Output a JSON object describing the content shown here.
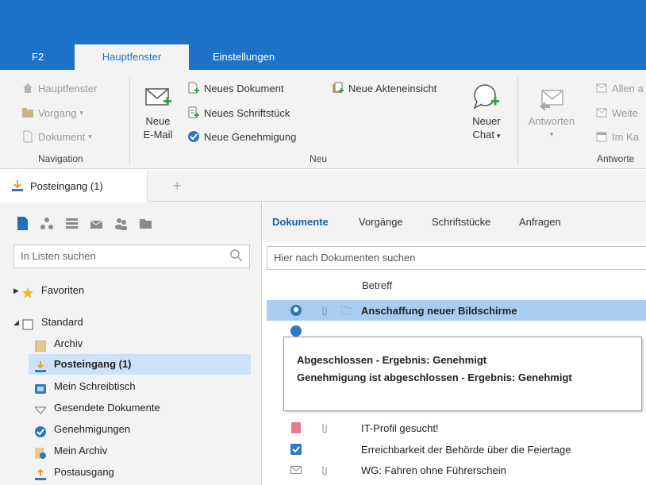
{
  "ribbon_tabs": [
    "F2",
    "Hauptfenster",
    "Einstellungen"
  ],
  "navigation": {
    "items": [
      "Hauptfenster",
      "Vorgang",
      "Dokument"
    ],
    "group_label": "Navigation"
  },
  "neu": {
    "neue_email_line1": "Neue",
    "neue_email_line2": "E-Mail",
    "items": [
      "Neues Dokument",
      "Neues Schriftstück",
      "Neue Genehmigung",
      "Neue Akteneinsicht"
    ],
    "neuer_chat_line1": "Neuer",
    "neuer_chat_line2": "Chat",
    "group_label": "Neu"
  },
  "antworten": {
    "big_label": "Antworten",
    "items": [
      "Allen a",
      "Weite",
      "Im Ka"
    ],
    "group_label": "Antworte"
  },
  "doc_tab": {
    "label": "Posteingang (1)",
    "add": "+"
  },
  "left": {
    "search_placeholder": "In Listen suchen",
    "tree": [
      "Favoriten",
      "Standard",
      "Archiv",
      "Posteingang (1)",
      "Mein Schreibtisch",
      "Gesendete Dokumente",
      "Genehmigungen",
      "Mein Archiv",
      "Postausgang"
    ]
  },
  "right": {
    "tabs": [
      "Dokumente",
      "Vorgänge",
      "Schriftstücke",
      "Anfragen"
    ],
    "search_placeholder": "Hier nach Dokumenten suchen",
    "column_header": "Betreff",
    "rows": [
      "Anschaffung neuer Bildschirme",
      "IT-Profil gesucht!",
      "Erreichbarkeit der Behörde über die Feiertage",
      "WG: Fahren ohne Führerschein"
    ]
  },
  "tooltip": {
    "line1": "Abgeschlossen - Ergebnis: Genehmigt",
    "line2": "Genehmigung ist abgeschlossen - Ergebnis: Genehmigt"
  },
  "colors": {
    "brand": "#1e73c8",
    "selection": "#a9cdf0",
    "ribbon_bg": "#f3f3f3"
  }
}
